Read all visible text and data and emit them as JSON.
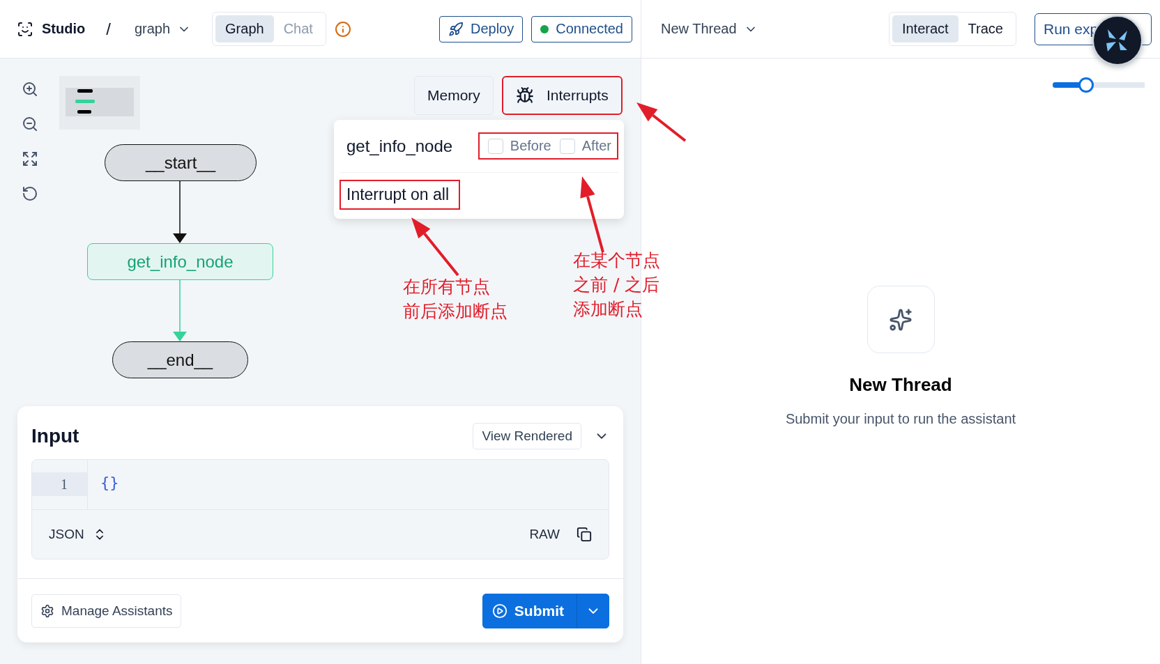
{
  "header": {
    "brand": "Studio",
    "separator": "/",
    "graph_selector": "graph",
    "view_tabs": [
      {
        "label": "Graph",
        "selected": true,
        "disabled": false
      },
      {
        "label": "Chat",
        "selected": false,
        "disabled": true
      }
    ],
    "deploy": "Deploy",
    "connection": {
      "label": "Connected",
      "connected": true
    }
  },
  "canvas": {
    "nodes": [
      {
        "label": "__start__",
        "kind": "terminal",
        "active": false
      },
      {
        "label": "get_info_node",
        "kind": "step",
        "active": true
      },
      {
        "label": "__end__",
        "kind": "terminal",
        "active": false
      }
    ],
    "panel_buttons": [
      {
        "label": "Memory",
        "highlighted": false
      },
      {
        "label": "Interrupts",
        "highlighted": true
      }
    ],
    "interrupts_menu": {
      "node": "get_info_node",
      "options_highlighted": true,
      "options": [
        {
          "label": "Before",
          "checked": false
        },
        {
          "label": "After",
          "checked": false
        }
      ],
      "interrupt_all": {
        "label": "Interrupt on all",
        "highlighted": true
      }
    },
    "annotations": [
      {
        "lines": [
          "在所有节点",
          "前后添加断点"
        ]
      },
      {
        "lines": [
          "在某个节点",
          "之前 / 之后",
          "添加断点"
        ]
      }
    ]
  },
  "input": {
    "title": "Input",
    "view_mode": "View Rendered",
    "editor": {
      "line_numbers": [
        "1"
      ],
      "value": "{}"
    },
    "format": "JSON",
    "raw_label": "RAW",
    "manage": "Manage Assistants",
    "submit": "Submit"
  },
  "thread": {
    "selector": "New Thread",
    "tabs": [
      {
        "label": "Interact",
        "selected": true
      },
      {
        "label": "Trace",
        "selected": false
      }
    ],
    "run_button": "Run exp",
    "zoom_slider": {
      "level": 0.36
    },
    "empty_state": {
      "title": "New Thread",
      "subtitle": "Submit your input to run the assistant"
    }
  }
}
